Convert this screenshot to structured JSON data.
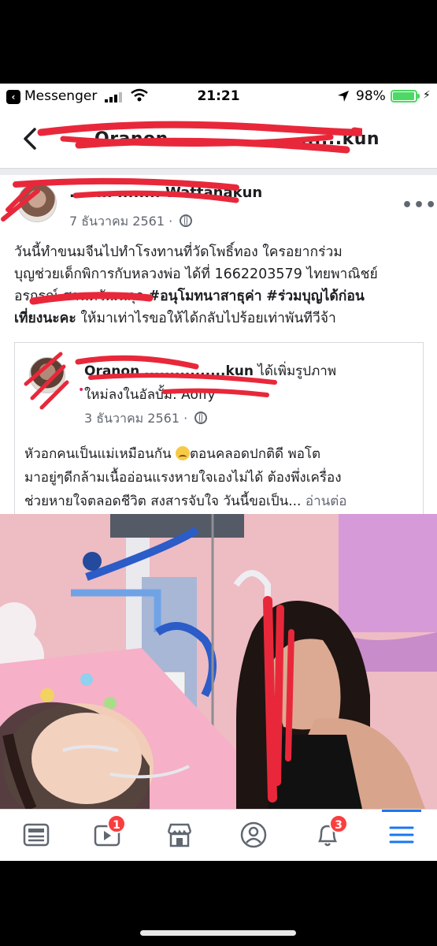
{
  "status_bar": {
    "back_app_label": "Messenger",
    "time": "21:21",
    "battery_percent": "98%",
    "battery_level": 0.98,
    "signal_bars": 3
  },
  "nav": {
    "title": "Oranon ........................kun"
  },
  "post": {
    "author": "........ ........ Wattanakun",
    "date": "7 ธันวาคม 2561",
    "text_lines": [
      "วันนี้ทำขนมจีนไปทำโรงทานที่วัดโพธิ์ทอง ใครอยากร่วม",
      "บุญช่วยเด็กพิการกับหลวงพ่อ ได้ที่ 1662203579 ไทยพาณิชย์",
      "อรกรณ์ ศานตวัฒนกุล ",
      "เที่ยงนะคะ",
      " ให้มาเท่าไรขอให้ได้กลับไปร้อยเท่าพันทีวีจ้า"
    ],
    "hashtag1": "#อนุโมทนาสาธุค่า",
    "hashtag2": "#ร่วมบุญได้ก่อน",
    "more_label": "•••"
  },
  "shared": {
    "author": "Oranon ................kun",
    "action": " ได้เพิ่มรูปภาพ",
    "line2": "ใหม่ลงในอัลบั้ม: Aoffy",
    "date": "3 ธันวาคม 2561",
    "text_line1": "หัวอกคนเป็นแม่เหมือนกัน ",
    "text_line1b": "ตอนคลอดปกติดี พอโต",
    "text_line2": "มาอยู่ๆดีกล้ามเนื้ออ่อนแรงหายใจเองไม่ได้ ต้องพึ่งเครื่อง",
    "text_line3": "ช่วยหายใจตลอดชีวิต  สงสารจับใจ วันนี้ขอเป็น... ",
    "read_more": "อ่านต่อ"
  },
  "tabbar": {
    "video_badge": "1",
    "notifications_badge": "3"
  },
  "colors": {
    "accent": "#1877f2",
    "badge": "#fa3e3e",
    "scribble": "#e8283a",
    "battery": "#4cd964"
  }
}
